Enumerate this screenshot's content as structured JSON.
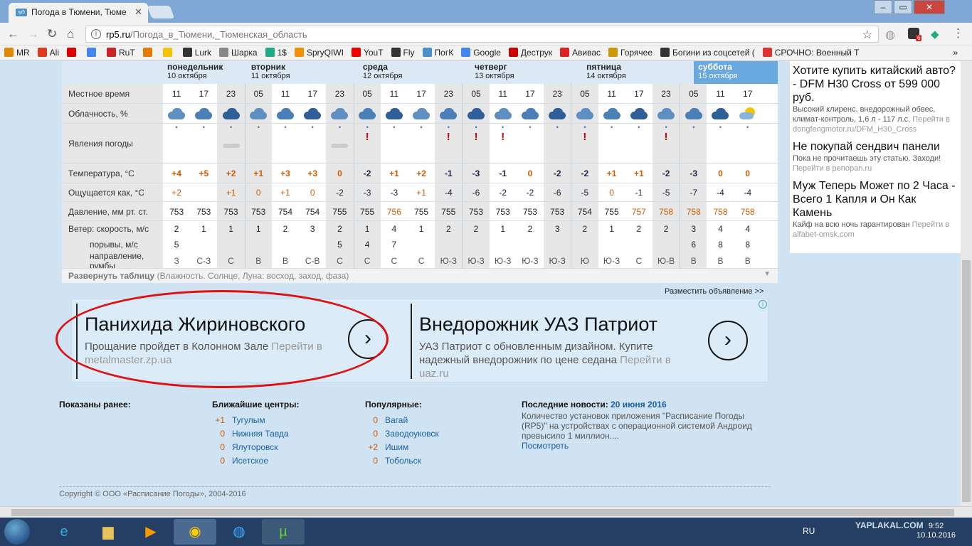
{
  "browser": {
    "tab_title": "Погода в Тюмени, Тюме",
    "favicon_text": "rp5",
    "url_host": "rp5.ru",
    "url_path": "/Погода_в_Тюмени,_Тюменская_область",
    "ext_badge": "6",
    "bookmarks": [
      {
        "label": "MR",
        "color": "#e08a00"
      },
      {
        "label": "Ali",
        "color": "#e03a1a"
      },
      {
        "label": "",
        "color": "#d00"
      },
      {
        "label": "",
        "color": "#4285f4"
      },
      {
        "label": "RuT",
        "color": "#c22"
      },
      {
        "label": "",
        "color": "#e87a00"
      },
      {
        "label": "",
        "color": "#f5c400"
      },
      {
        "label": "Lurk",
        "color": "#333"
      },
      {
        "label": "Шарка",
        "color": "#888"
      },
      {
        "label": "1$",
        "color": "#2a8"
      },
      {
        "label": "SpryQIWI",
        "color": "#f29000"
      },
      {
        "label": "YouT",
        "color": "#e00"
      },
      {
        "label": "Fly",
        "color": "#333"
      },
      {
        "label": "ПогК",
        "color": "#4a90c8"
      },
      {
        "label": "Google",
        "color": "#4285f4"
      },
      {
        "label": "Деструк",
        "color": "#c00"
      },
      {
        "label": "Авивас",
        "color": "#d22"
      },
      {
        "label": "Горячее",
        "color": "#c90"
      },
      {
        "label": "Богини из соцсетей (",
        "color": "#333"
      },
      {
        "label": "СРОЧНО: Военный Т",
        "color": "#d33"
      }
    ],
    "bookmarks_more": "»"
  },
  "forecast": {
    "days": [
      {
        "name": "понедельник",
        "date": "10 октября"
      },
      {
        "name": "вторник",
        "date": "11 октября"
      },
      {
        "name": "среда",
        "date": "12 октября"
      },
      {
        "name": "четверг",
        "date": "13 октября"
      },
      {
        "name": "пятница",
        "date": "14 октября"
      },
      {
        "name": "суббота",
        "date": "15 октября"
      }
    ],
    "labels": {
      "time": "Местное время",
      "cloud": "Облачность, %",
      "phen": "Явления погоды",
      "temp": "Температура, °C",
      "feels": "Ощущается как, °C",
      "press": "Давление, мм рт. ст.",
      "wind": "Ветер: скорость, м/с",
      "gusts": "порывы, м/с",
      "dir": "направление, румбы"
    },
    "times": [
      "11",
      "17",
      "23",
      "05",
      "11",
      "17",
      "23",
      "05",
      "11",
      "17",
      "23",
      "05",
      "11",
      "17",
      "23",
      "05",
      "11",
      "17",
      "23",
      "05",
      "11",
      "17"
    ],
    "temp": [
      "+4",
      "+5",
      "+2",
      "+1",
      "+3",
      "+3",
      "0",
      "-2",
      "+1",
      "+2",
      "-1",
      "-3",
      "-1",
      "0",
      "-2",
      "-2",
      "+1",
      "+1",
      "-2",
      "-3",
      "0",
      "0"
    ],
    "feels": [
      "+2",
      "",
      "+1",
      "0",
      "+1",
      "0",
      "-2",
      "-3",
      "-3",
      "+1",
      "-4",
      "-6",
      "-2",
      "-2",
      "-6",
      "-5",
      "0",
      "-1",
      "-5",
      "-7",
      "-4",
      "-4"
    ],
    "press": [
      "753",
      "753",
      "753",
      "753",
      "754",
      "754",
      "755",
      "755",
      "756",
      "755",
      "755",
      "753",
      "753",
      "753",
      "753",
      "754",
      "755",
      "757",
      "758",
      "758",
      "758",
      "758"
    ],
    "wind": [
      "2",
      "1",
      "1",
      "1",
      "2",
      "3",
      "2",
      "1",
      "4",
      "1",
      "2",
      "2",
      "1",
      "2",
      "3",
      "2",
      "1",
      "2",
      "2",
      "3",
      "4",
      "4"
    ],
    "gusts": [
      "5",
      "",
      "",
      "",
      "",
      "",
      "5",
      "4",
      "7",
      "",
      "",
      "",
      "",
      "",
      "",
      "",
      "",
      "",
      "",
      "6",
      "8",
      "8"
    ],
    "dir": [
      "З",
      "С-З",
      "С",
      "В",
      "В",
      "С-В",
      "С",
      "С",
      "С",
      "С",
      "Ю-З",
      "Ю-З",
      "Ю-З",
      "Ю-З",
      "Ю-З",
      "Ю",
      "Ю-З",
      "С",
      "Ю-В",
      "В",
      "В",
      "В"
    ],
    "expand_bold": "Развернуть таблицу",
    "expand_rest": " (Влажность. Солнце, Луна: восход, заход, фаза)"
  },
  "ads": {
    "place_ad": "Разместить объявление >>",
    "ad1": {
      "title": "Панихида Жириновского",
      "text": "Прощание пройдет в Колонном Зале",
      "link": "Перейти в metalmaster.zp.ua"
    },
    "ad2": {
      "title": "Внедорожник УАЗ Патриот",
      "text": "УАЗ Патриот с обновленным дизайном. Купите надежный внедорожник по цене седана",
      "link": "Перейти в uaz.ru"
    },
    "arrow": "›",
    "info": "i"
  },
  "right_ads": [
    {
      "title": "Хотите купить китайский авто? - DFM H30 Cross от 599 000 руб.",
      "desc": "Высокий клиренс, внедорожный обвес, климат-контроль, 1,6 л - 117 л.с.",
      "link": "Перейти в dongfengmotor.ru/DFM_H30_Cross"
    },
    {
      "title": "Не покупай сендвич панели",
      "desc": "Пока не прочитаешь эту статью. Заходи!",
      "link": "Перейти в penopan.ru"
    },
    {
      "title": "Муж Теперь Может по 2 Часа - Всего 1 Капля и Он Как Камень",
      "desc": "Кайф на всю ночь гарантирован",
      "link": "Перейти в alfabet-omsk.com"
    }
  ],
  "bottom": {
    "recent_title": "Показаны ранее:",
    "centers_title": "Ближайшие центры:",
    "centers": [
      {
        "n": "+1",
        "name": "Тугулым"
      },
      {
        "n": "0",
        "name": "Нижняя Тавда"
      },
      {
        "n": "0",
        "name": "Ялуторовск"
      },
      {
        "n": "0",
        "name": "Исетское"
      }
    ],
    "popular_title": "Популярные:",
    "popular": [
      {
        "n": "0",
        "name": "Вагай"
      },
      {
        "n": "0",
        "name": "Заводоуковск"
      },
      {
        "n": "+2",
        "name": "Ишим"
      },
      {
        "n": "0",
        "name": "Тобольск"
      }
    ],
    "news_title": "Последние новости:",
    "news_date": "20 июня 2016",
    "news_text": "Количество установок приложения \"Расписание Погоды (RP5)\" на устройствах с операционной системой Андроид превысило 1 миллион....",
    "news_more": "Посмотреть",
    "copyright": "Copyright © ООО «Расписание Погоды», 2004-2016"
  },
  "taskbar": {
    "lang": "RU",
    "time": "9:52",
    "date": "10.10.2016",
    "watermark": "YAPLAKAL.COM"
  }
}
